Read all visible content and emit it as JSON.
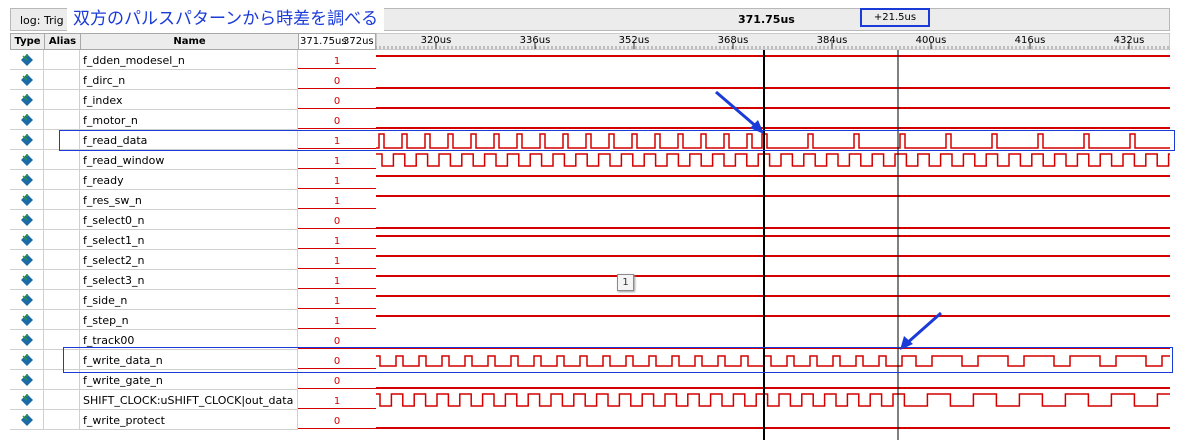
{
  "toolbar": {
    "log_label": "log: Trig @",
    "annotation": "双方のパルスパターンから時差を調べる",
    "time_title": "371.75us",
    "delta": "+21.5us"
  },
  "columns": {
    "type": "Type",
    "alias": "Alias",
    "name": "Name",
    "value_time_1": "371.75us",
    "value_time_2": "372us"
  },
  "timeline": {
    "ticks": [
      "320us",
      "336us",
      "352us",
      "368us",
      "384us",
      "400us",
      "416us",
      "432us"
    ]
  },
  "signals": [
    {
      "name": "f_dden_modesel_n",
      "value": "1"
    },
    {
      "name": "f_dirc_n",
      "value": "0"
    },
    {
      "name": "f_index",
      "value": "0"
    },
    {
      "name": "f_motor_n",
      "value": "0"
    },
    {
      "name": "f_read_data",
      "value": "1"
    },
    {
      "name": "f_read_window",
      "value": "1"
    },
    {
      "name": "f_ready",
      "value": "1"
    },
    {
      "name": "f_res_sw_n",
      "value": "1"
    },
    {
      "name": "f_select0_n",
      "value": "0"
    },
    {
      "name": "f_select1_n",
      "value": "1"
    },
    {
      "name": "f_select2_n",
      "value": "1"
    },
    {
      "name": "f_select3_n",
      "value": "1"
    },
    {
      "name": "f_side_n",
      "value": "1"
    },
    {
      "name": "f_step_n",
      "value": "1"
    },
    {
      "name": "f_track00",
      "value": "0"
    },
    {
      "name": "f_write_data_n",
      "value": "0"
    },
    {
      "name": "f_write_gate_n",
      "value": "0"
    },
    {
      "name": "SHIFT_CLOCK:uSHIFT_CLOCK|out_data",
      "value": "1"
    },
    {
      "name": "f_write_protect",
      "value": "0"
    }
  ],
  "tooltip": "1",
  "colors": {
    "waveform": "#d40000",
    "annotation": "#1a3bd8",
    "icon": "#1a6aa8"
  }
}
